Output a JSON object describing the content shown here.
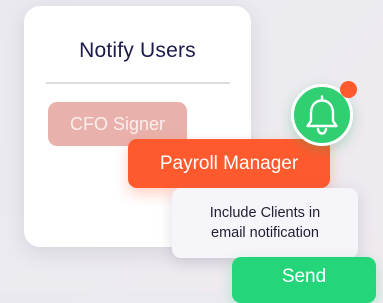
{
  "panel": {
    "title": "Notify Users"
  },
  "chips": {
    "cfo_signer": "CFO Signer",
    "payroll_manager": "Payroll Manager"
  },
  "option": {
    "include_clients_line1": "Include Clients in",
    "include_clients_line2": "email notification"
  },
  "actions": {
    "send_label": "Send"
  },
  "icons": {
    "bell": "bell-icon",
    "notification_dot": "notification-dot"
  },
  "colors": {
    "title_text": "#1b1a4b",
    "chip_inactive": "#e9b1ab",
    "chip_active": "#ff5a2e",
    "send_button": "#24d679",
    "bell_circle": "#2fcf72",
    "notification_dot": "#ff5a2e"
  }
}
